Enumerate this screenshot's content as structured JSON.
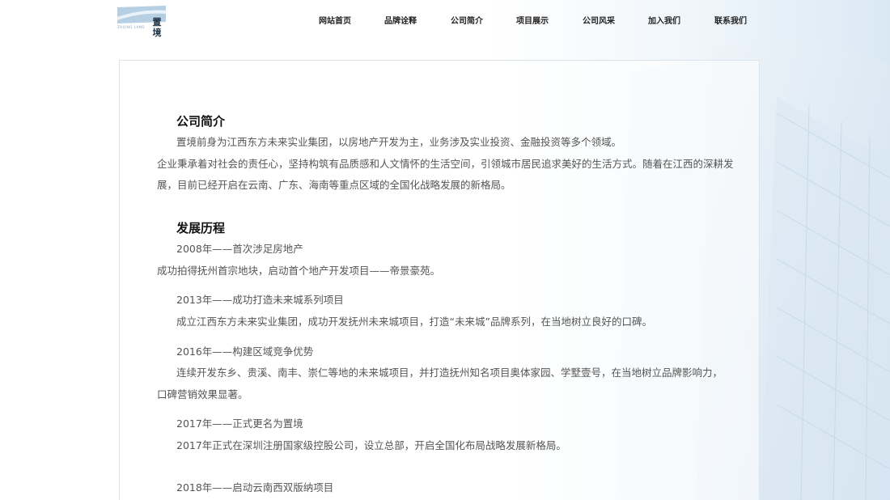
{
  "header": {
    "logo": {
      "name": "置境",
      "tagline": "ZHIJING LAND"
    },
    "nav": [
      "网站首页",
      "品牌诠释",
      "公司简介",
      "项目展示",
      "公司风采",
      "加入我们",
      "联系我们"
    ]
  },
  "intro": {
    "title": "公司简介",
    "p1": "置境前身为江西东方未来实业集团，以房地产开发为主，业务涉及实业投资、金融投资等多个领域。",
    "p2_line1": "企业秉承着对社会的责任心，坚持构筑有品质感和人文情怀的生活空间，引领城市居民追求美好的生活方式。随着在江西的深耕发",
    "p2_line2": "展，目前已经开启在云南、广东、海南等重点区域的全国化战略发展的新格局。"
  },
  "history": {
    "title": "发展历程",
    "events": [
      {
        "heading": "2008年——首次涉足房地产",
        "lines": [
          "成功拍得抚州首宗地块，启动首个地产开发项目——帝景豪苑。"
        ]
      },
      {
        "heading": "2013年——成功打造未来城系列项目",
        "lines": [
          "成立江西东方未来实业集团，成功开发抚州未来城项目，打造“未来城”品牌系列，在当地树立良好的口碑。"
        ]
      },
      {
        "heading": "2016年——构建区域竞争优势",
        "lines": [
          "连续开发东乡、贵溪、南丰、崇仁等地的未来城项目，并打造抚州知名项目奥体家园、学墅壹号，在当地树立品牌影响力，",
          "口碑营销效果显著。"
        ]
      },
      {
        "heading": "2017年——正式更名为置境",
        "lines": [
          "2017年正式在深圳注册国家级控股公司，设立总部，开启全国化布局战略发展新格局。"
        ]
      },
      {
        "heading": "2018年——启动云南西双版纳项目",
        "lines": []
      }
    ]
  }
}
